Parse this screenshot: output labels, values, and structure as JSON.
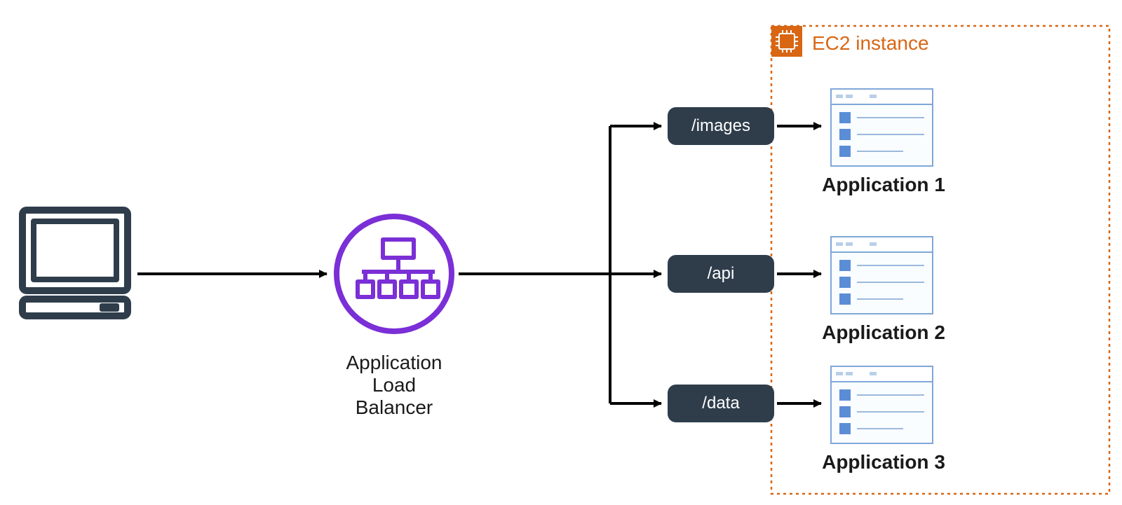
{
  "diagram": {
    "alb_label": "Application Load\nBalancer",
    "ec2_title": "EC2 instance",
    "routes": [
      {
        "path": "/images",
        "app_label": "Application 1"
      },
      {
        "path": "/api",
        "app_label": "Application 2"
      },
      {
        "path": "/data",
        "app_label": "Application 3"
      }
    ],
    "colors": {
      "slate": "#2f3d4b",
      "purple": "#7b2fd6",
      "orange": "#d86613",
      "blue_light": "#5b8dd6",
      "blue": "#3e78c8",
      "black": "#000000"
    }
  }
}
